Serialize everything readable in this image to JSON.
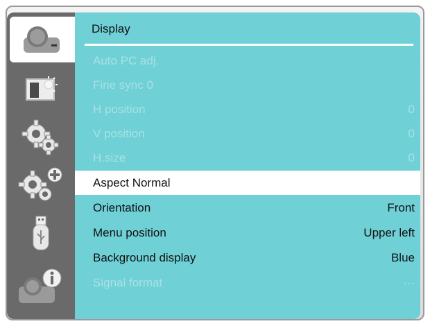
{
  "menu": {
    "title": "Display",
    "items": [
      {
        "label": "Auto PC adj.",
        "value": "",
        "state": "disabled"
      },
      {
        "label": "Fine sync 0",
        "value": "",
        "state": "disabled"
      },
      {
        "label": "H position",
        "value": "0",
        "state": "disabled"
      },
      {
        "label": "V position",
        "value": "0",
        "state": "disabled"
      },
      {
        "label": "H.size",
        "value": "0",
        "state": "disabled"
      },
      {
        "label": "Aspect Normal",
        "value": "",
        "state": "selected"
      },
      {
        "label": "Orientation",
        "value": "Front",
        "state": "enabled"
      },
      {
        "label": "Menu position",
        "value": "Upper left",
        "state": "enabled"
      },
      {
        "label": "Background display",
        "value": "Blue",
        "state": "enabled"
      },
      {
        "label": "Signal format",
        "value": "···",
        "state": "disabled"
      }
    ]
  },
  "sidebar": {
    "items": [
      {
        "icon": "display-icon",
        "active": true
      },
      {
        "icon": "picture-adjust-icon",
        "active": false
      },
      {
        "icon": "settings-gears-icon",
        "active": false
      },
      {
        "icon": "advanced-settings-icon",
        "active": false
      },
      {
        "icon": "usb-icon",
        "active": false
      },
      {
        "icon": "info-icon",
        "active": false
      }
    ]
  },
  "colors": {
    "panel": "#6fd0d6",
    "sidebar": "#6a6a6a",
    "selected_row": "#ffffff",
    "disabled_text": "#a7e2e5"
  }
}
